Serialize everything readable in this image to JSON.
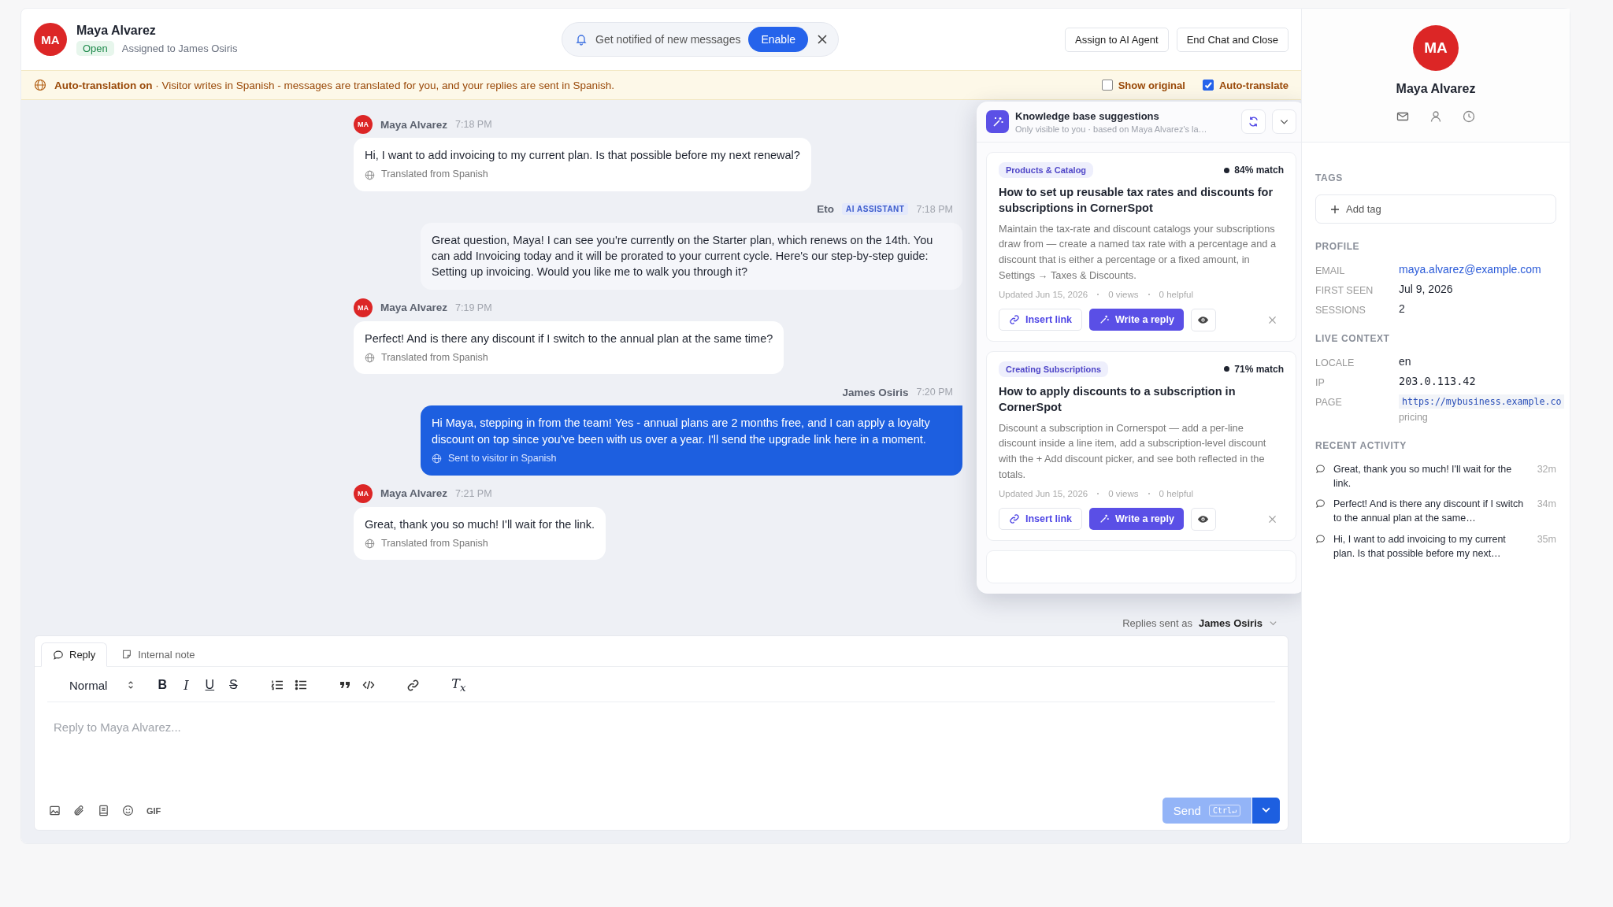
{
  "header": {
    "initials": "MA",
    "name": "Maya Alvarez",
    "status": "Open",
    "assigned": "Assigned to James Osiris",
    "notify": {
      "text": "Get notified of new messages",
      "button": "Enable"
    },
    "actions": [
      "Assign to AI Agent",
      "End Chat and Close"
    ]
  },
  "banner": {
    "title": "Auto-translation on",
    "text": "· Visitor writes in Spanish - messages are translated for you, and your replies are sent in Spanish.",
    "options": [
      {
        "label": "Show original",
        "checked": false
      },
      {
        "label": "Auto-translate",
        "checked": true
      }
    ]
  },
  "messages": [
    {
      "kind": "visitor",
      "initials": "MA",
      "author": "Maya Alvarez",
      "time": "7:18 PM",
      "text": "Hi, I want to add invoicing to my current plan. Is that possible before my next renewal?",
      "note": "Translated from Spanish"
    },
    {
      "kind": "ai",
      "author": "Eto",
      "badge": "AI ASSISTANT",
      "time": "7:18 PM",
      "text": "Great question, Maya! I can see you're currently on the Starter plan, which renews on the 14th. You can add Invoicing today and it will be prorated to your current cycle. Here's our step-by-step guide: Setting up invoicing. Would you like me to walk you through it?"
    },
    {
      "kind": "visitor",
      "initials": "MA",
      "author": "Maya Alvarez",
      "time": "7:19 PM",
      "text": "Perfect! And is there any discount if I switch to the annual plan at the same time?",
      "note": "Translated from Spanish"
    },
    {
      "kind": "agent",
      "author": "James Osiris",
      "time": "7:20 PM",
      "text": "Hi Maya, stepping in from the team! Yes - annual plans are 2 months free, and I can apply a loyalty discount on top since you've been with us over a year. I'll send the upgrade link here in a moment.",
      "note": "Sent to visitor in Spanish"
    },
    {
      "kind": "visitor",
      "initials": "MA",
      "author": "Maya Alvarez",
      "time": "7:21 PM",
      "text": "Great, thank you so much! I'll wait for the link.",
      "note": "Translated from Spanish"
    }
  ],
  "kb": {
    "title": "Knowledge base suggestions",
    "subtitle": "Only visible to you · based on Maya Alvarez's la…",
    "cards": [
      {
        "category": "Products & Catalog",
        "match": "84% match",
        "title": "How to set up reusable tax rates and discounts for subscriptions in CornerSpot",
        "body": "Maintain the tax-rate and discount catalogs your subscriptions draw from — create a named tax rate with a percentage and a discount that is either a percentage or a fixed amount, in Settings → Taxes & Discounts.",
        "meta": [
          "Updated Jun 15, 2026",
          "0 views",
          "0 helpful"
        ],
        "insert": "Insert link",
        "write": "Write a reply"
      },
      {
        "category": "Creating Subscriptions",
        "match": "71% match",
        "title": "How to apply discounts to a subscription in CornerSpot",
        "body": "Discount a subscription in Cornerspot — add a per-line discount inside a line item, add a subscription-level discount with the + Add discount picker, and see both reflected in the totals.",
        "meta": [
          "Updated Jun 15, 2026",
          "0 views",
          "0 helpful"
        ],
        "insert": "Insert link",
        "write": "Write a reply"
      }
    ]
  },
  "replies_as": {
    "label": "Replies sent as",
    "name": "James Osiris"
  },
  "composer": {
    "tabs": [
      {
        "label": "Reply",
        "selected": true
      },
      {
        "label": "Internal note",
        "selected": false
      }
    ],
    "format": "Normal",
    "marks": [
      "B",
      "I",
      "U",
      "S"
    ],
    "clear": "T$_{x}$",
    "placeholder": "Reply to Maya Alvarez...",
    "gif": "GIF",
    "send": "Send",
    "shortcut": "Ctrl↵"
  },
  "sidebar": {
    "initials": "MA",
    "name": "Maya Alvarez",
    "tags_heading": "TAGS",
    "add_tag": "Add tag",
    "sections": [
      {
        "heading": "PROFILE",
        "fields": [
          {
            "label": "EMAIL",
            "value": "maya.alvarez@example.com",
            "kind": "link"
          },
          {
            "label": "FIRST SEEN",
            "value": "Jul 9, 2026",
            "kind": "text"
          },
          {
            "label": "SESSIONS",
            "value": "2",
            "kind": "text"
          }
        ]
      },
      {
        "heading": "LIVE CONTEXT",
        "fields": [
          {
            "label": "LOCALE",
            "value": "en",
            "kind": "text"
          },
          {
            "label": "IP",
            "value": "203.0.113.42",
            "kind": "mono"
          },
          {
            "label": "PAGE",
            "value": "https://mybusiness.example.co",
            "kind": "code",
            "sub": "pricing"
          }
        ]
      }
    ],
    "activity_heading": "RECENT ACTIVITY",
    "activity": [
      {
        "text": "Great, thank you so much! I'll wait for the link.",
        "time": "32m"
      },
      {
        "text": "Perfect! And is there any discount if I switch to the annual plan at the same…",
        "time": "34m"
      },
      {
        "text": "Hi, I want to add invoicing to my current plan. Is that possible before my next…",
        "time": "35m"
      }
    ]
  }
}
